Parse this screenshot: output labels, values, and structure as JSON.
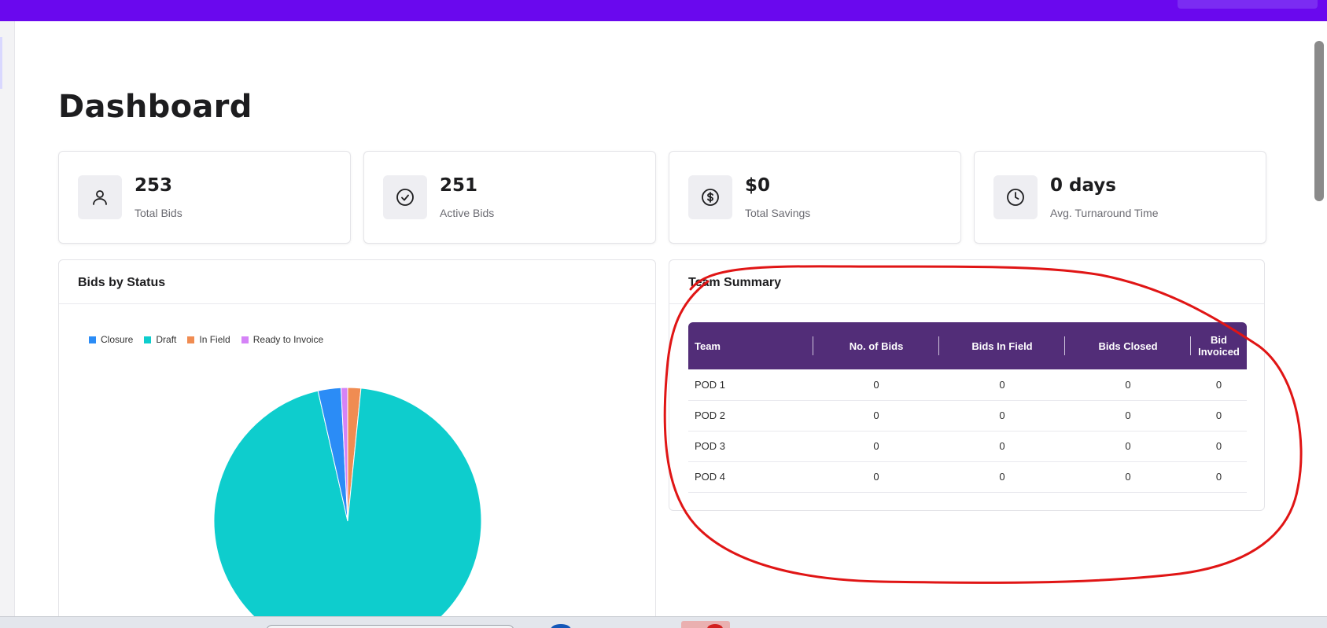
{
  "page": {
    "title": "Dashboard"
  },
  "stats": [
    {
      "value": "253",
      "label": "Total Bids",
      "icon": "user-icon"
    },
    {
      "value": "251",
      "label": "Active Bids",
      "icon": "check-circle-icon"
    },
    {
      "value": "$0",
      "label": "Total Savings",
      "icon": "dollar-circle-icon"
    },
    {
      "value": "0 days",
      "label": "Avg. Turnaround Time",
      "icon": "clock-icon"
    }
  ],
  "bids_panel": {
    "title": "Bids by Status"
  },
  "team_panel": {
    "title": "Team Summary",
    "columns": [
      "Team",
      "No. of Bids",
      "Bids In Field",
      "Bids Closed",
      "Bid Invoiced"
    ],
    "rows": [
      [
        "POD 1",
        "0",
        "0",
        "0",
        "0"
      ],
      [
        "POD 2",
        "0",
        "0",
        "0",
        "0"
      ],
      [
        "POD 3",
        "0",
        "0",
        "0",
        "0"
      ],
      [
        "POD 4",
        "0",
        "0",
        "0",
        "0"
      ]
    ]
  },
  "colors": {
    "topbar": "#6a08ee",
    "table_header": "#522d78",
    "annotation": "#e01515"
  },
  "chart_data": {
    "type": "pie",
    "title": "",
    "legend_position": "top-left",
    "categories": [
      "Closure",
      "Draft",
      "In Field",
      "Ready to Invoice"
    ],
    "values": [
      7,
      239,
      4,
      2
    ],
    "colors": [
      "#2b8cf6",
      "#0ecdcd",
      "#f08c52",
      "#d583f7"
    ]
  }
}
